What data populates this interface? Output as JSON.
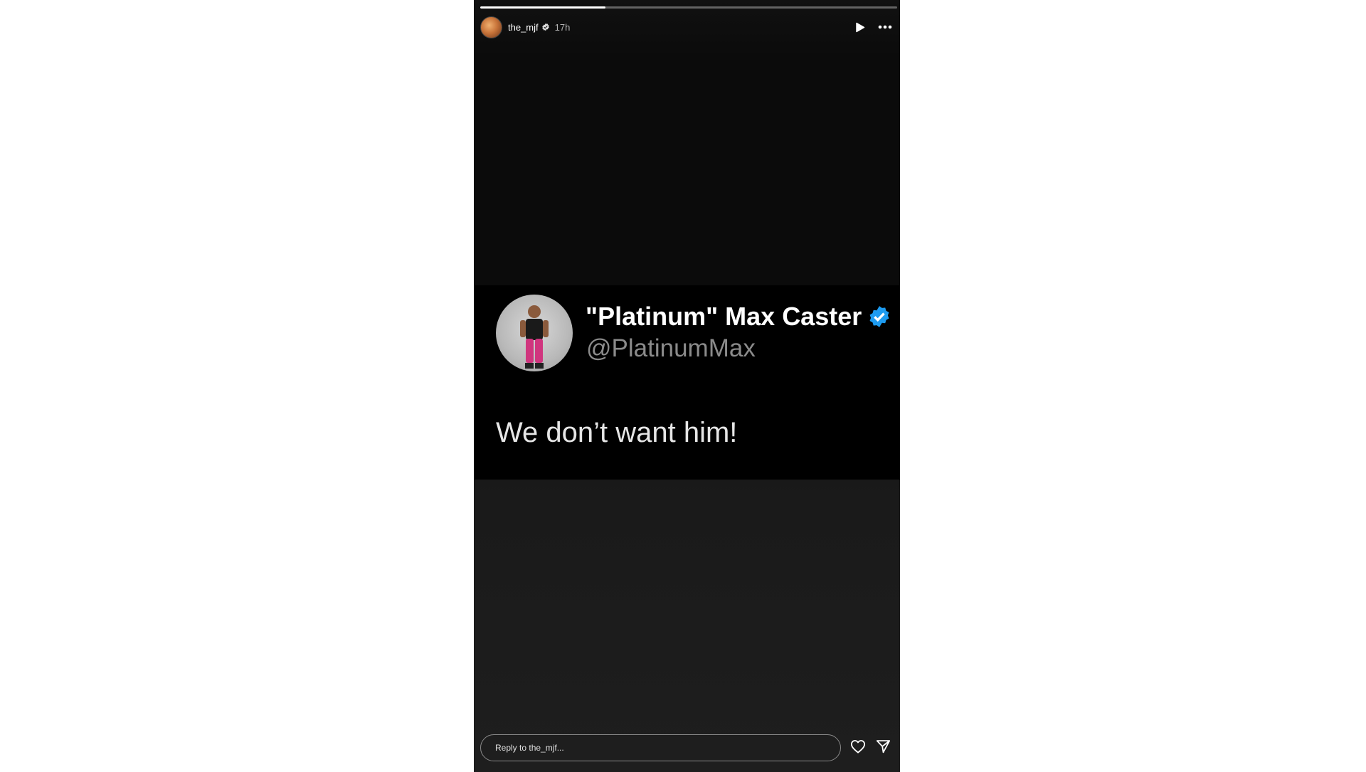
{
  "story": {
    "progress": 0.3,
    "username": "the_mjf",
    "time": "17h",
    "icons": {
      "verified": "verified-badge-icon",
      "play": "play-icon",
      "more": "more-icon"
    }
  },
  "tweet": {
    "name": "\"Platinum\" Max Caster",
    "handle": "@PlatinumMax",
    "text": "We don’t want him!",
    "verified_color": "#1d9bf0"
  },
  "reply": {
    "placeholder": "Reply to the_mjf...",
    "icons": {
      "like": "heart-icon",
      "share": "send-icon"
    }
  }
}
